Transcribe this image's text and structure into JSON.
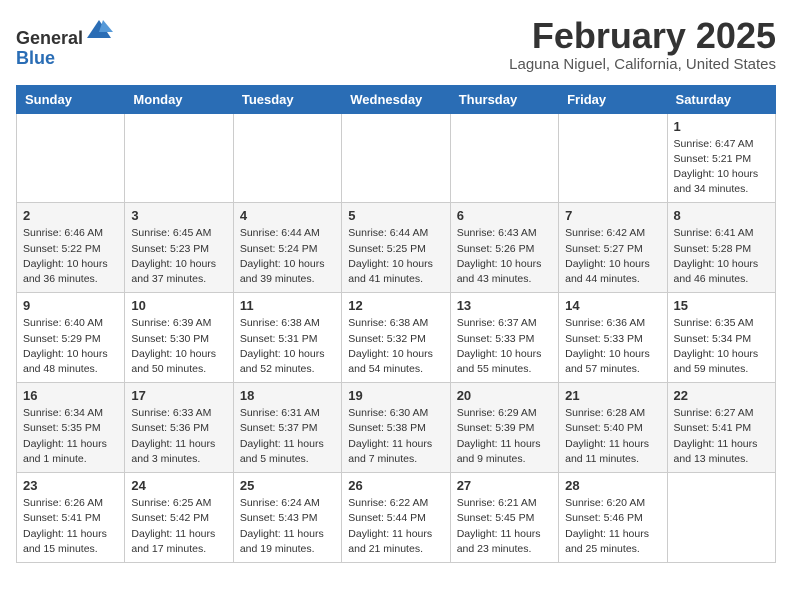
{
  "header": {
    "logo_line1": "General",
    "logo_line2": "Blue",
    "month": "February 2025",
    "location": "Laguna Niguel, California, United States"
  },
  "weekdays": [
    "Sunday",
    "Monday",
    "Tuesday",
    "Wednesday",
    "Thursday",
    "Friday",
    "Saturday"
  ],
  "weeks": [
    [
      {
        "day": "",
        "info": ""
      },
      {
        "day": "",
        "info": ""
      },
      {
        "day": "",
        "info": ""
      },
      {
        "day": "",
        "info": ""
      },
      {
        "day": "",
        "info": ""
      },
      {
        "day": "",
        "info": ""
      },
      {
        "day": "1",
        "info": "Sunrise: 6:47 AM\nSunset: 5:21 PM\nDaylight: 10 hours\nand 34 minutes."
      }
    ],
    [
      {
        "day": "2",
        "info": "Sunrise: 6:46 AM\nSunset: 5:22 PM\nDaylight: 10 hours\nand 36 minutes."
      },
      {
        "day": "3",
        "info": "Sunrise: 6:45 AM\nSunset: 5:23 PM\nDaylight: 10 hours\nand 37 minutes."
      },
      {
        "day": "4",
        "info": "Sunrise: 6:44 AM\nSunset: 5:24 PM\nDaylight: 10 hours\nand 39 minutes."
      },
      {
        "day": "5",
        "info": "Sunrise: 6:44 AM\nSunset: 5:25 PM\nDaylight: 10 hours\nand 41 minutes."
      },
      {
        "day": "6",
        "info": "Sunrise: 6:43 AM\nSunset: 5:26 PM\nDaylight: 10 hours\nand 43 minutes."
      },
      {
        "day": "7",
        "info": "Sunrise: 6:42 AM\nSunset: 5:27 PM\nDaylight: 10 hours\nand 44 minutes."
      },
      {
        "day": "8",
        "info": "Sunrise: 6:41 AM\nSunset: 5:28 PM\nDaylight: 10 hours\nand 46 minutes."
      }
    ],
    [
      {
        "day": "9",
        "info": "Sunrise: 6:40 AM\nSunset: 5:29 PM\nDaylight: 10 hours\nand 48 minutes."
      },
      {
        "day": "10",
        "info": "Sunrise: 6:39 AM\nSunset: 5:30 PM\nDaylight: 10 hours\nand 50 minutes."
      },
      {
        "day": "11",
        "info": "Sunrise: 6:38 AM\nSunset: 5:31 PM\nDaylight: 10 hours\nand 52 minutes."
      },
      {
        "day": "12",
        "info": "Sunrise: 6:38 AM\nSunset: 5:32 PM\nDaylight: 10 hours\nand 54 minutes."
      },
      {
        "day": "13",
        "info": "Sunrise: 6:37 AM\nSunset: 5:33 PM\nDaylight: 10 hours\nand 55 minutes."
      },
      {
        "day": "14",
        "info": "Sunrise: 6:36 AM\nSunset: 5:33 PM\nDaylight: 10 hours\nand 57 minutes."
      },
      {
        "day": "15",
        "info": "Sunrise: 6:35 AM\nSunset: 5:34 PM\nDaylight: 10 hours\nand 59 minutes."
      }
    ],
    [
      {
        "day": "16",
        "info": "Sunrise: 6:34 AM\nSunset: 5:35 PM\nDaylight: 11 hours\nand 1 minute."
      },
      {
        "day": "17",
        "info": "Sunrise: 6:33 AM\nSunset: 5:36 PM\nDaylight: 11 hours\nand 3 minutes."
      },
      {
        "day": "18",
        "info": "Sunrise: 6:31 AM\nSunset: 5:37 PM\nDaylight: 11 hours\nand 5 minutes."
      },
      {
        "day": "19",
        "info": "Sunrise: 6:30 AM\nSunset: 5:38 PM\nDaylight: 11 hours\nand 7 minutes."
      },
      {
        "day": "20",
        "info": "Sunrise: 6:29 AM\nSunset: 5:39 PM\nDaylight: 11 hours\nand 9 minutes."
      },
      {
        "day": "21",
        "info": "Sunrise: 6:28 AM\nSunset: 5:40 PM\nDaylight: 11 hours\nand 11 minutes."
      },
      {
        "day": "22",
        "info": "Sunrise: 6:27 AM\nSunset: 5:41 PM\nDaylight: 11 hours\nand 13 minutes."
      }
    ],
    [
      {
        "day": "23",
        "info": "Sunrise: 6:26 AM\nSunset: 5:41 PM\nDaylight: 11 hours\nand 15 minutes."
      },
      {
        "day": "24",
        "info": "Sunrise: 6:25 AM\nSunset: 5:42 PM\nDaylight: 11 hours\nand 17 minutes."
      },
      {
        "day": "25",
        "info": "Sunrise: 6:24 AM\nSunset: 5:43 PM\nDaylight: 11 hours\nand 19 minutes."
      },
      {
        "day": "26",
        "info": "Sunrise: 6:22 AM\nSunset: 5:44 PM\nDaylight: 11 hours\nand 21 minutes."
      },
      {
        "day": "27",
        "info": "Sunrise: 6:21 AM\nSunset: 5:45 PM\nDaylight: 11 hours\nand 23 minutes."
      },
      {
        "day": "28",
        "info": "Sunrise: 6:20 AM\nSunset: 5:46 PM\nDaylight: 11 hours\nand 25 minutes."
      },
      {
        "day": "",
        "info": ""
      }
    ]
  ]
}
